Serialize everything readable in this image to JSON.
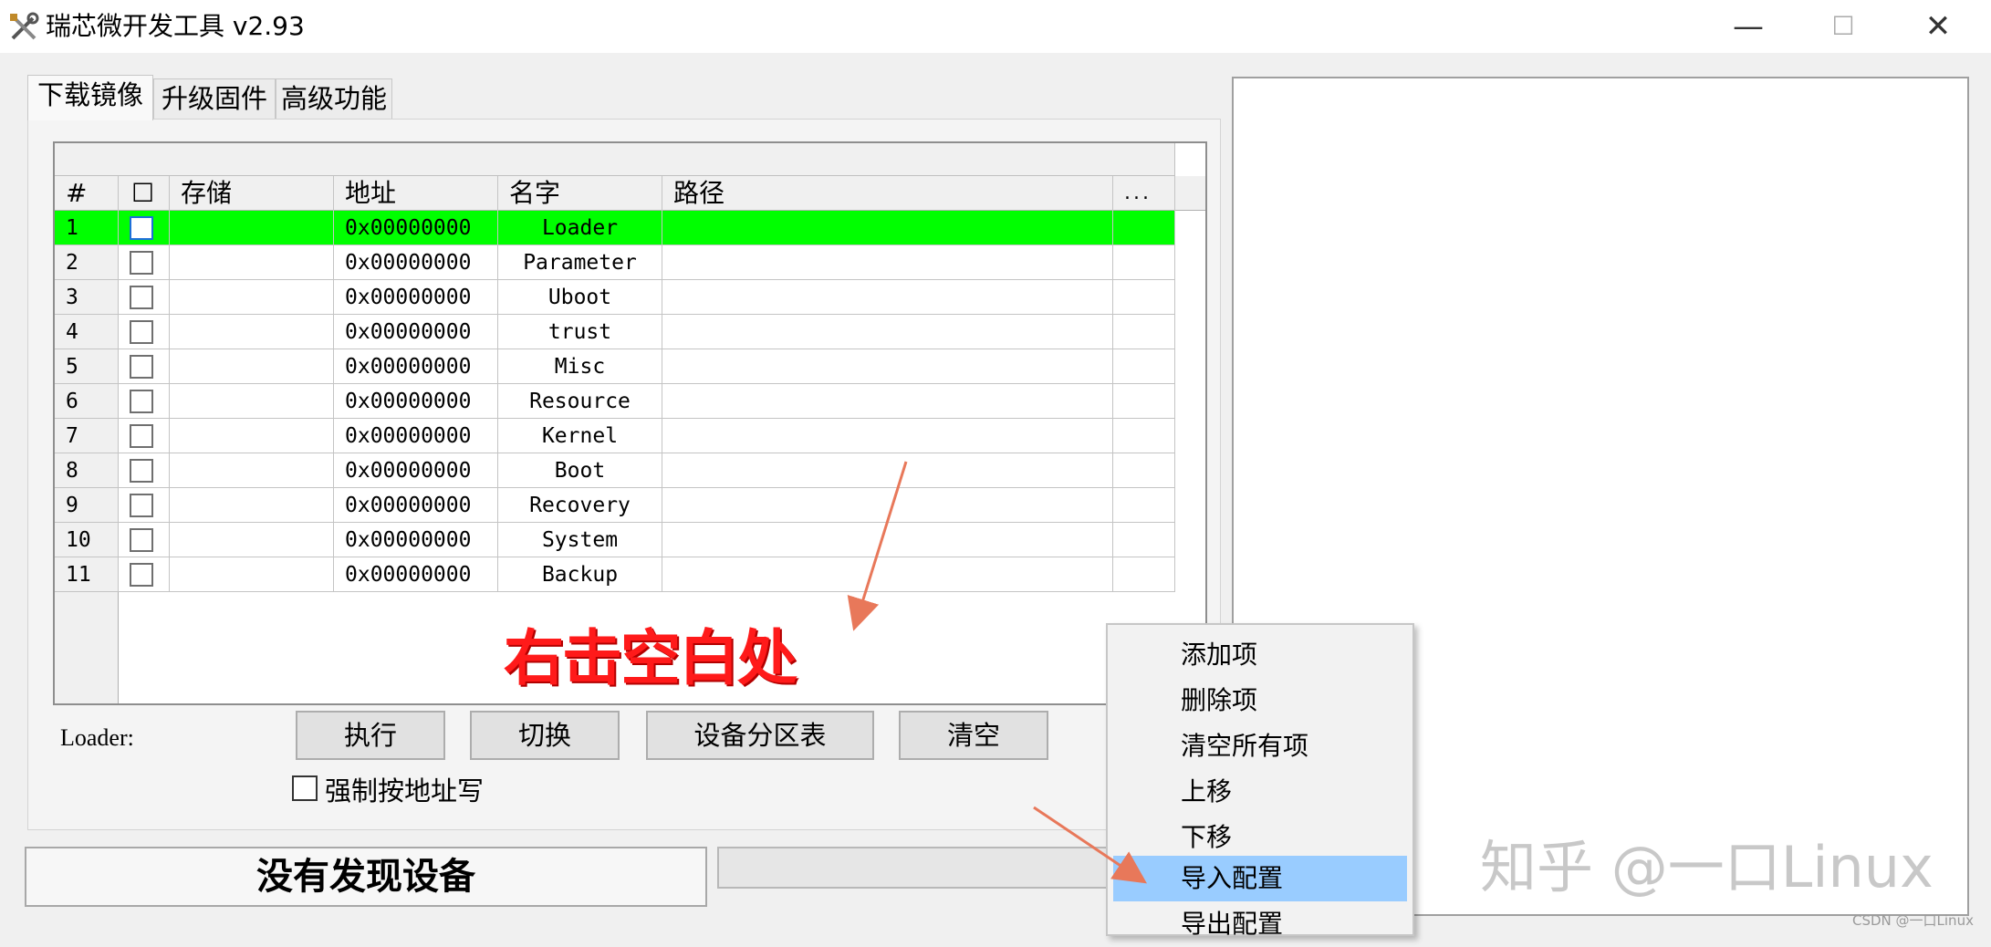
{
  "window": {
    "title": "瑞芯微开发工具 v2.93",
    "icon": "tools-icon",
    "min_glyph": "—",
    "max_glyph": "☐",
    "close_glyph": "✕"
  },
  "tabs": [
    {
      "label": "下载镜像",
      "active": true
    },
    {
      "label": "升级固件",
      "active": false
    },
    {
      "label": "高级功能",
      "active": false
    }
  ],
  "grid": {
    "columns": {
      "num": "#",
      "check": "☐",
      "storage": "存储",
      "address": "地址",
      "name": "名字",
      "path": "路径",
      "more": "..."
    },
    "rows": [
      {
        "num": "1",
        "address": "0x00000000",
        "name": "Loader",
        "highlighted": true
      },
      {
        "num": "2",
        "address": "0x00000000",
        "name": "Parameter"
      },
      {
        "num": "3",
        "address": "0x00000000",
        "name": "Uboot"
      },
      {
        "num": "4",
        "address": "0x00000000",
        "name": "trust"
      },
      {
        "num": "5",
        "address": "0x00000000",
        "name": "Misc"
      },
      {
        "num": "6",
        "address": "0x00000000",
        "name": "Resource"
      },
      {
        "num": "7",
        "address": "0x00000000",
        "name": "Kernel"
      },
      {
        "num": "8",
        "address": "0x00000000",
        "name": "Boot"
      },
      {
        "num": "9",
        "address": "0x00000000",
        "name": "Recovery"
      },
      {
        "num": "10",
        "address": "0x00000000",
        "name": "System"
      },
      {
        "num": "11",
        "address": "0x00000000",
        "name": "Backup"
      }
    ],
    "highlight_color": "#00ff00"
  },
  "controls": {
    "loader_label": "Loader:",
    "execute": "执行",
    "switch": "切换",
    "partition_table": "设备分区表",
    "clear": "清空",
    "force_write": "强制按地址写"
  },
  "status": {
    "text": "没有发现设备"
  },
  "annotation": {
    "text": "右击空白处",
    "color": "#ff1a1a"
  },
  "context_menu": {
    "items": [
      {
        "label": "添加项"
      },
      {
        "label": "删除项"
      },
      {
        "label": "清空所有项"
      },
      {
        "label": "上移"
      },
      {
        "label": "下移"
      },
      {
        "label": "导入配置",
        "selected": true
      },
      {
        "label": "导出配置"
      }
    ],
    "selected_color": "#99ccff"
  },
  "watermarks": {
    "zhihu": "知乎 @一口Linux",
    "csdn": "CSDN @一口Linux"
  }
}
